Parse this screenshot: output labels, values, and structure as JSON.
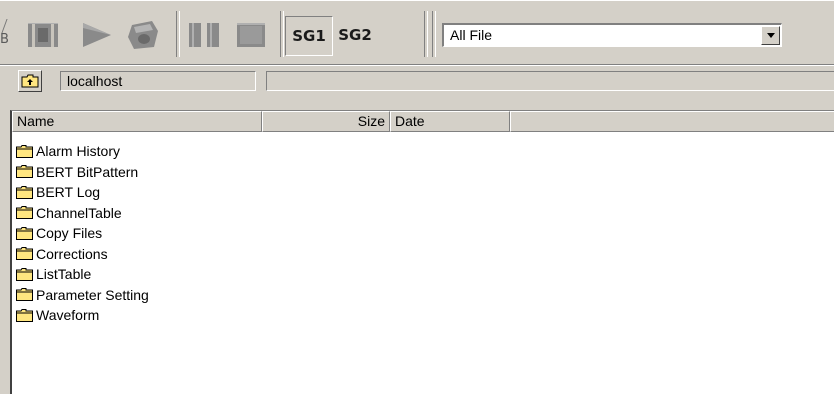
{
  "toolbar": {
    "cutoff_label": "B",
    "sg1_label": "SG1",
    "sg2_label": "SG2",
    "file_filter": "All File"
  },
  "path": {
    "host": "localhost",
    "current_path": ""
  },
  "list": {
    "columns": [
      "Name",
      "Size",
      "Date",
      ""
    ],
    "items": [
      {
        "name": "Alarm History"
      },
      {
        "name": "BERT BitPattern"
      },
      {
        "name": "BERT Log"
      },
      {
        "name": "ChannelTable"
      },
      {
        "name": "Copy Files"
      },
      {
        "name": "Corrections"
      },
      {
        "name": "ListTable"
      },
      {
        "name": "Parameter Setting"
      },
      {
        "name": "Waveform"
      }
    ]
  },
  "icons": {
    "toolbar": [
      "record-icon",
      "play-icon",
      "save-disk-icon",
      "pause-icon",
      "stop-icon"
    ],
    "path_up": "folder-up-icon",
    "row": "folder-icon"
  },
  "colors": {
    "window_bg": "#d4d0c8",
    "icon_gray": "#8a8a8a",
    "folder_yellow": "#ffe680"
  }
}
